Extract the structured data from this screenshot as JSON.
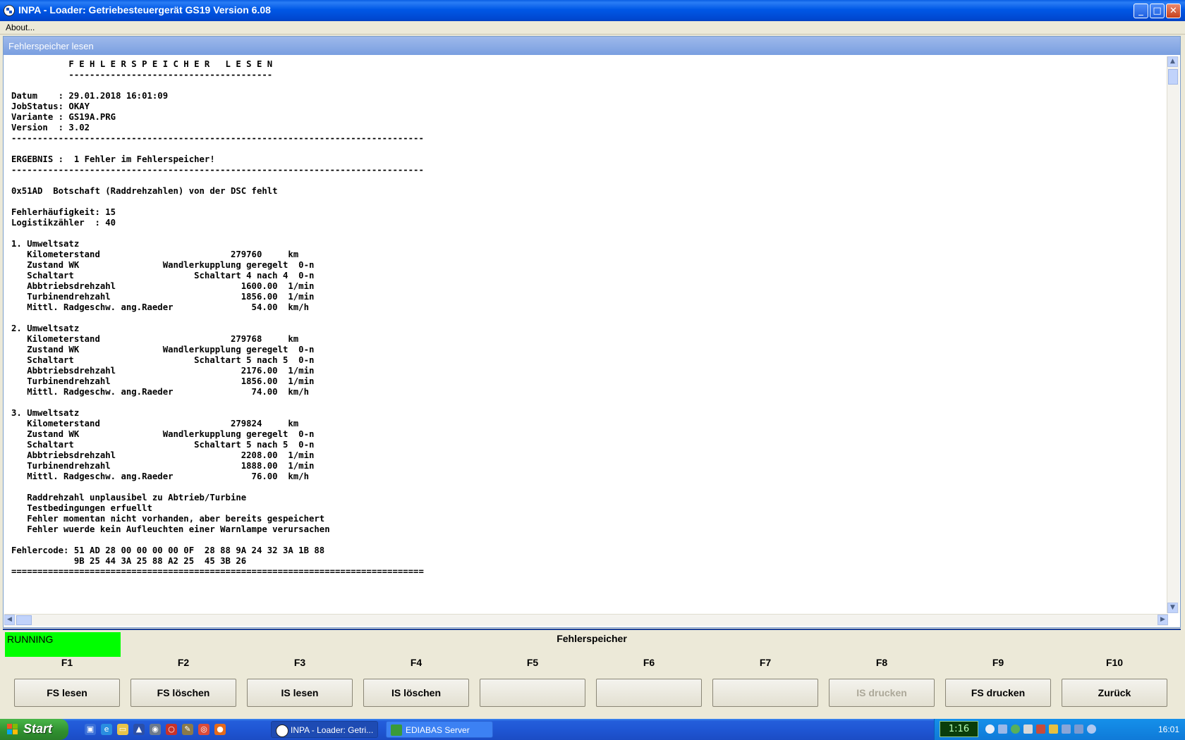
{
  "window": {
    "title": "INPA - Loader:  Getriebesteuergerät GS19 Version 6.08",
    "min_glyph": "_",
    "max_glyph": "□",
    "close_glyph": "✕"
  },
  "menu": {
    "about": "About..."
  },
  "child_window": {
    "title": "Fehlerspeicher lesen"
  },
  "report_lines": [
    "           F E H L E R S P E I C H E R   L E S E N",
    "           ---------------------------------------",
    "",
    "Datum    : 29.01.2018 16:01:09",
    "JobStatus: OKAY",
    "Variante : GS19A.PRG",
    "Version  : 3.02",
    "-------------------------------------------------------------------------------",
    "",
    "ERGEBNIS :  1 Fehler im Fehlerspeicher!",
    "-------------------------------------------------------------------------------",
    "",
    "0x51AD  Botschaft (Raddrehzahlen) von der DSC fehlt",
    "",
    "Fehlerhäufigkeit: 15",
    "Logistikzähler  : 40",
    "",
    "1. Umweltsatz",
    "   Kilometerstand                         279760     km",
    "   Zustand WK                Wandlerkupplung geregelt  0-n",
    "   Schaltart                       Schaltart 4 nach 4  0-n",
    "   Abbtriebsdrehzahl                        1600.00  1/min",
    "   Turbinendrehzahl                         1856.00  1/min",
    "   Mittl. Radgeschw. ang.Raeder               54.00  km/h",
    "",
    "2. Umweltsatz",
    "   Kilometerstand                         279768     km",
    "   Zustand WK                Wandlerkupplung geregelt  0-n",
    "   Schaltart                       Schaltart 5 nach 5  0-n",
    "   Abbtriebsdrehzahl                        2176.00  1/min",
    "   Turbinendrehzahl                         1856.00  1/min",
    "   Mittl. Radgeschw. ang.Raeder               74.00  km/h",
    "",
    "3. Umweltsatz",
    "   Kilometerstand                         279824     km",
    "   Zustand WK                Wandlerkupplung geregelt  0-n",
    "   Schaltart                       Schaltart 5 nach 5  0-n",
    "   Abbtriebsdrehzahl                        2208.00  1/min",
    "   Turbinendrehzahl                         1888.00  1/min",
    "   Mittl. Radgeschw. ang.Raeder               76.00  km/h",
    "",
    "   Raddrehzahl unplausibel zu Abtrieb/Turbine",
    "   Testbedingungen erfuellt",
    "   Fehler momentan nicht vorhanden, aber bereits gespeichert",
    "   Fehler wuerde kein Aufleuchten einer Warnlampe verursachen",
    "",
    "Fehlercode: 51 AD 28 00 00 00 00 0F  28 88 9A 24 32 3A 1B 88",
    "            9B 25 44 3A 25 88 A2 25  45 3B 26",
    "==============================================================================="
  ],
  "status": {
    "running": "RUNNING",
    "section_title": "Fehlerspeicher",
    "running_color": "#00ff00"
  },
  "fkeys": [
    {
      "key": "F1",
      "label": "FS lesen",
      "enabled": true
    },
    {
      "key": "F2",
      "label": "FS löschen",
      "enabled": true
    },
    {
      "key": "F3",
      "label": "IS lesen",
      "enabled": true
    },
    {
      "key": "F4",
      "label": "IS löschen",
      "enabled": true
    },
    {
      "key": "F5",
      "label": "",
      "enabled": true
    },
    {
      "key": "F6",
      "label": "",
      "enabled": true
    },
    {
      "key": "F7",
      "label": "",
      "enabled": true
    },
    {
      "key": "F8",
      "label": "IS drucken",
      "enabled": false
    },
    {
      "key": "F9",
      "label": "FS drucken",
      "enabled": true
    },
    {
      "key": "F10",
      "label": "Zurück",
      "enabled": true
    }
  ],
  "taskbar": {
    "start_label": "Start",
    "tasks": [
      {
        "label": "INPA - Loader:  Getri...",
        "active": true
      },
      {
        "label": "EDIABAS Server",
        "active": false
      }
    ],
    "tray_box": "1:16",
    "time": "16:01"
  },
  "colors": {
    "accent": "#0058e6",
    "child_title": "#7a9fe0",
    "taskbar": "#245edb"
  }
}
